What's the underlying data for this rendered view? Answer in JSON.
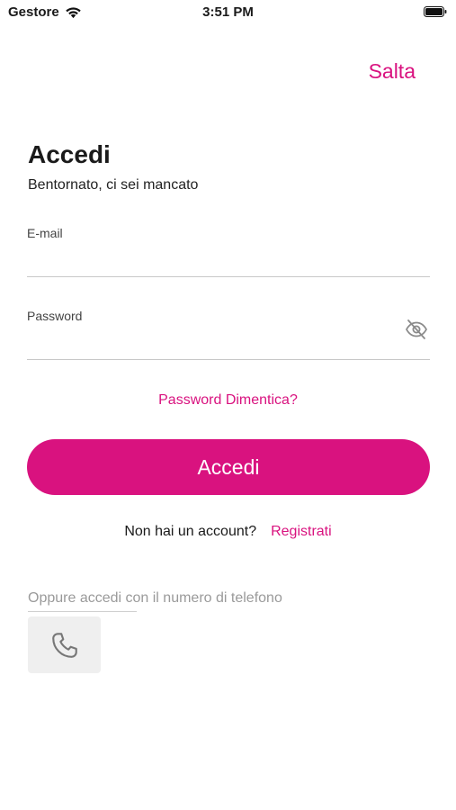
{
  "status_bar": {
    "carrier": "Gestore",
    "time": "3:51 PM"
  },
  "header": {
    "skip_label": "Salta"
  },
  "login": {
    "title": "Accedi",
    "subtitle": "Bentornato, ci sei mancato",
    "email_label": "E-mail",
    "email_value": "",
    "password_label": "Password",
    "password_value": "",
    "forgot_label": "Password Dimentica?",
    "submit_label": "Accedi",
    "signup_prompt": "Non hai un account?",
    "signup_link": "Registrati",
    "phone_hint": "Oppure accedi con il numero di telefono"
  },
  "icons": {
    "wifi": "wifi-icon",
    "battery": "battery-icon",
    "password_toggle": "eye-off-icon",
    "phone": "phone-icon"
  },
  "colors": {
    "accent": "#d9127f",
    "hint_text": "#9a9a9a",
    "phone_button_bg": "#efefef"
  }
}
